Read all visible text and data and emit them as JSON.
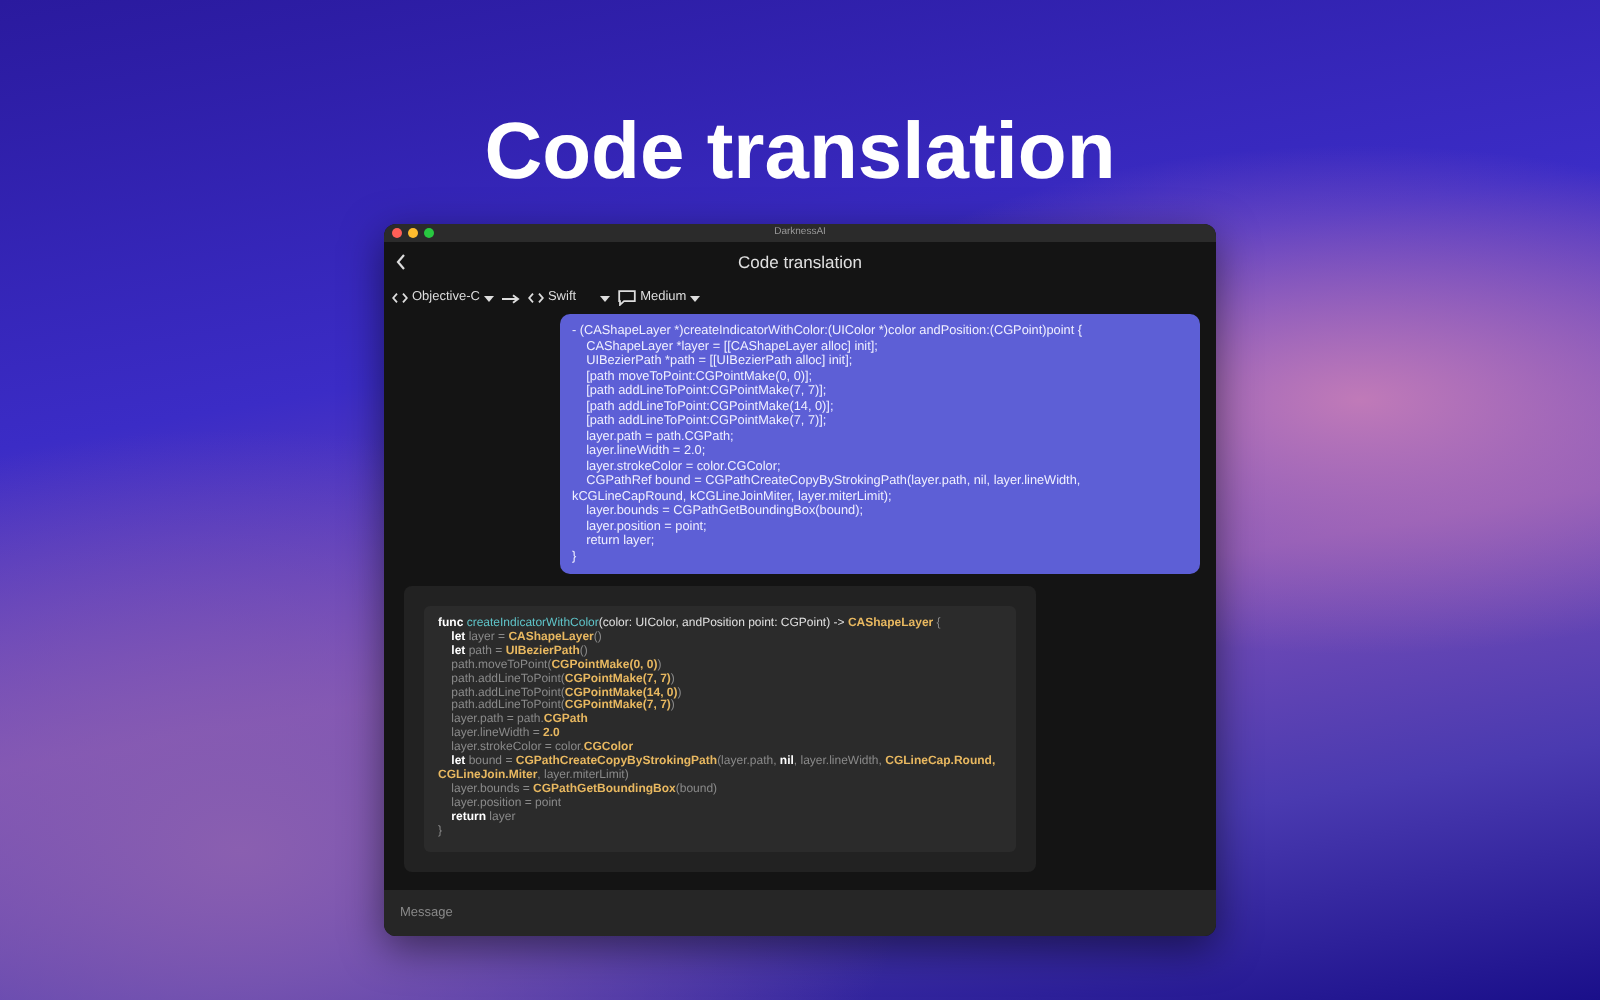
{
  "headline": "Code translation",
  "window": {
    "title": "DarknessAI"
  },
  "header": {
    "title": "Code translation"
  },
  "toolbar": {
    "source_language": "Objective-C",
    "target_language": "Swift",
    "length": "Medium"
  },
  "conversation": [
    {
      "kind": "request",
      "lines": [
        "- (CAShapeLayer *)createIndicatorWithColor:(UIColor *)color andPosition:(CGPoint)point {",
        "    CAShapeLayer *layer = [[CAShapeLayer alloc] init];",
        "    UIBezierPath *path = [[UIBezierPath alloc] init];",
        "    [path moveToPoint:CGPointMake(0, 0)];",
        "    [path addLineToPoint:CGPointMake(7, 7)];",
        "    [path addLineToPoint:CGPointMake(14, 0)];",
        "    [path addLineToPoint:CGPointMake(7, 7)];",
        "    layer.path = path.CGPath;",
        "    layer.lineWidth = 2.0;",
        "    layer.strokeColor = color.CGColor;",
        "    CGPathRef bound = CGPathCreateCopyByStrokingPath(layer.path, nil, layer.lineWidth,",
        "kCGLineCapRound, kCGLineJoinMiter, layer.miterLimit);",
        "    layer.bounds = CGPathGetBoundingBox(bound);",
        "    layer.position = point;",
        "    return layer;",
        "}"
      ]
    },
    {
      "kind": "response",
      "code": [
        [
          {
            "kind": "kw",
            "text": "func "
          },
          {
            "kind": "fn",
            "text": "createIndicatorWithColor"
          },
          {
            "kind": "text",
            "text": "(color: UIColor, andPosition point: CGPoint) -> "
          },
          {
            "kind": "type",
            "text": "CAShapeLayer"
          },
          {
            "kind": "plain",
            "text": " {"
          }
        ],
        [
          {
            "kind": "kw",
            "text": "    let"
          },
          {
            "kind": "plain",
            "text": " layer = "
          },
          {
            "kind": "type",
            "text": "CAShapeLayer"
          },
          {
            "kind": "plain",
            "text": "()"
          }
        ],
        [
          {
            "kind": "kw",
            "text": "    let"
          },
          {
            "kind": "plain",
            "text": " path = "
          },
          {
            "kind": "type",
            "text": "UIBezierPath"
          },
          {
            "kind": "plain",
            "text": "()"
          }
        ],
        [
          {
            "kind": "plain",
            "text": "    path.moveToPoint("
          },
          {
            "kind": "type",
            "text": "CGPointMake(0, 0)"
          },
          {
            "kind": "plain",
            "text": ")"
          }
        ],
        [
          {
            "kind": "plain",
            "text": "    path.addLineToPoint("
          },
          {
            "kind": "type",
            "text": "CGPointMake(7, 7)"
          },
          {
            "kind": "plain",
            "text": ")"
          }
        ],
        [
          {
            "kind": "plain",
            "text": "    path.addLineToPoint("
          },
          {
            "kind": "type",
            "text": "CGPointMake(14, 0)"
          },
          {
            "kind": "plain",
            "text": ")"
          }
        ],
        [
          {
            "kind": "plain",
            "text": "    path.addLineToPoint("
          },
          {
            "kind": "type",
            "text": "CGPointMake(7, 7)"
          },
          {
            "kind": "plain",
            "text": ")"
          }
        ],
        [
          {
            "kind": "plain",
            "text": "    layer.path = path."
          },
          {
            "kind": "type",
            "text": "CGPath"
          }
        ],
        [
          {
            "kind": "plain",
            "text": "    layer.lineWidth = "
          },
          {
            "kind": "type",
            "text": "2.0"
          }
        ],
        [
          {
            "kind": "plain",
            "text": "    layer.strokeColor = color."
          },
          {
            "kind": "type",
            "text": "CGColor"
          }
        ],
        [
          {
            "kind": "kw",
            "text": "    let"
          },
          {
            "kind": "plain",
            "text": " bound = "
          },
          {
            "kind": "type",
            "text": "CGPathCreateCopyByStrokingPath"
          },
          {
            "kind": "plain",
            "text": "(layer.path, "
          },
          {
            "kind": "kw",
            "text": "nil"
          },
          {
            "kind": "plain",
            "text": ", layer.lineWidth, "
          },
          {
            "kind": "type",
            "text": "CGLineCap.Round,"
          }
        ],
        [
          {
            "kind": "type",
            "text": "CGLineJoin.Miter"
          },
          {
            "kind": "plain",
            "text": ", layer.miterLimit)"
          }
        ],
        [
          {
            "kind": "plain",
            "text": "    layer.bounds = "
          },
          {
            "kind": "type",
            "text": "CGPathGetBoundingBox"
          },
          {
            "kind": "plain",
            "text": "(bound)"
          }
        ],
        [
          {
            "kind": "plain",
            "text": "    layer.position = point"
          }
        ],
        [
          {
            "kind": "kw",
            "text": "    return"
          },
          {
            "kind": "plain",
            "text": " layer"
          }
        ],
        [
          {
            "kind": "plain",
            "text": "}"
          }
        ]
      ]
    }
  ],
  "composer": {
    "placeholder": "Message"
  }
}
